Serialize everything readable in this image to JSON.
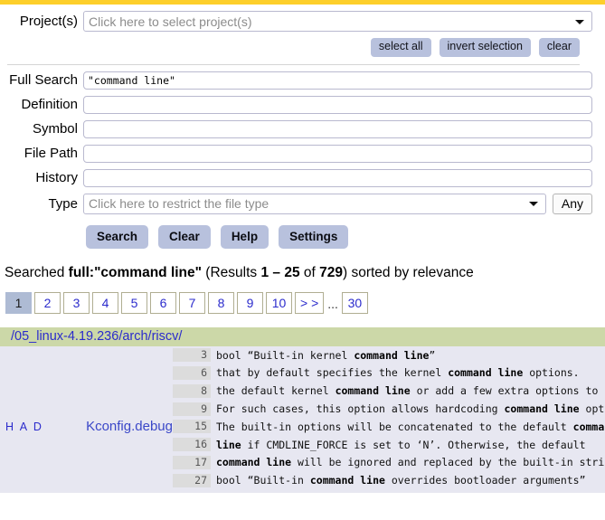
{
  "theme": {
    "topbar_color": "#fdcf2b",
    "button_color": "#b8c1dd",
    "dir_header_color": "#ccd8a8",
    "result_bg_color": "#e7e7f1",
    "link_color": "#2b2bcc"
  },
  "form": {
    "project_label": "Project(s)",
    "project_placeholder": "Click here to select project(s)",
    "project_buttons": [
      "select all",
      "invert selection",
      "clear"
    ],
    "fields": [
      {
        "label": "Full Search",
        "value": "\"command line\"",
        "placeholder": ""
      },
      {
        "label": "Definition",
        "value": "",
        "placeholder": ""
      },
      {
        "label": "Symbol",
        "value": "",
        "placeholder": ""
      },
      {
        "label": "File Path",
        "value": "",
        "placeholder": ""
      },
      {
        "label": "History",
        "value": "",
        "placeholder": ""
      }
    ],
    "type_label": "Type",
    "type_placeholder": "Click here to restrict the file type",
    "type_any_label": "Any",
    "actions": [
      "Search",
      "Clear",
      "Help",
      "Settings"
    ]
  },
  "results_summary": {
    "prefix": "Searched ",
    "query": "full:\"command line\"",
    "results_text": " (Results ",
    "range": "1 – 25",
    "of": " of ",
    "total": "729",
    "suffix": ") sorted by relevance"
  },
  "pagination": {
    "pages": [
      "1",
      "2",
      "3",
      "4",
      "5",
      "6",
      "7",
      "8",
      "9",
      "10",
      "> >"
    ],
    "active": "1",
    "ellipsis": "...",
    "last": "30"
  },
  "directory": {
    "path": "/05_linux-4.19.236/arch/riscv/"
  },
  "file_entry": {
    "flags": "H A D",
    "filename": "Kconfig.debug"
  },
  "matches": [
    {
      "line": "3",
      "pre": "bool “Built-in kernel ",
      "hit": "command line",
      "post": "”"
    },
    {
      "line": "6",
      "pre": "that by default specifies the kernel ",
      "hit": "command line",
      "post": " options."
    },
    {
      "line": "8",
      "pre": "the default kernel ",
      "hit": "command line",
      "post": " or add a few extra options to it."
    },
    {
      "line": "9",
      "pre": "For such cases, this option allows hardcoding ",
      "hit": "command line",
      "post": " options"
    },
    {
      "line": "15",
      "pre": "The built-in options will be concatenated to the default ",
      "hit": "command",
      "post": ""
    },
    {
      "line": "16",
      "pre": "",
      "hit": "line",
      "post": " if CMDLINE_FORCE is set to ‘N’. Otherwise, the default"
    },
    {
      "line": "17",
      "pre": "",
      "hit": "command line",
      "post": " will be ignored and replaced by the built-in string."
    },
    {
      "line": "27",
      "pre": "bool “Built-in ",
      "hit": "command line",
      "post": " overrides bootloader arguments”"
    }
  ]
}
